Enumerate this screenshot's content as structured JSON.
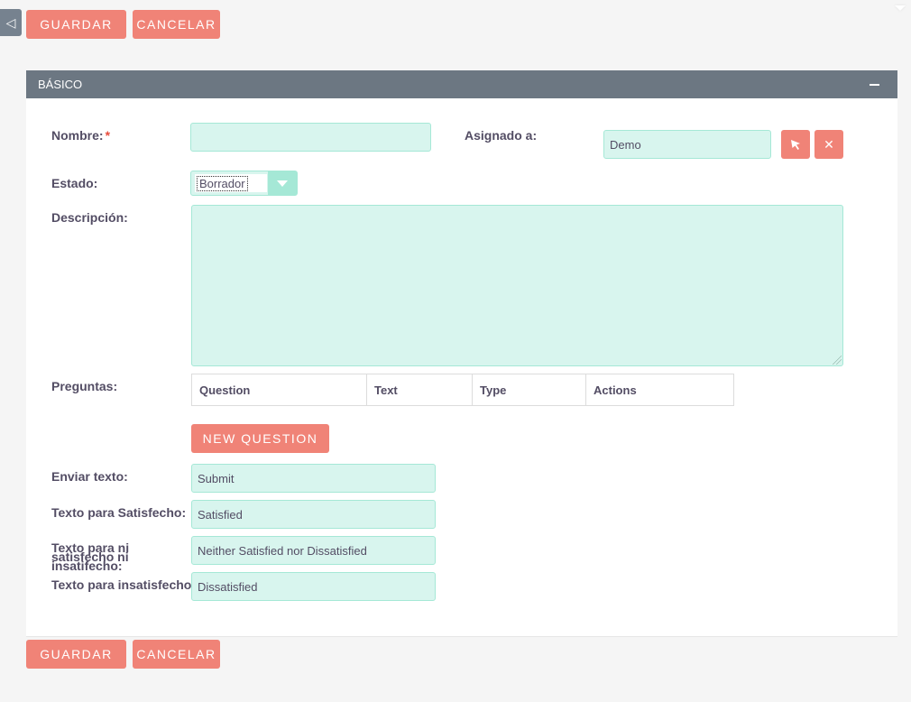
{
  "toolbar": {
    "save_label": "GUARDAR",
    "cancel_label": "CANCELAR"
  },
  "panel": {
    "title": "BÁSICO"
  },
  "form": {
    "nombre_label": "Nombre:",
    "required_mark": "*",
    "nombre_value": "",
    "asignado_label": "Asignado a:",
    "asignado_value": "Demo",
    "estado_label": "Estado:",
    "estado_value": "Borrador",
    "descripcion_label": "Descripción:",
    "descripcion_value": "",
    "preguntas_label": "Preguntas:",
    "questions_table": {
      "columns": [
        "Question",
        "Text",
        "Type",
        "Actions"
      ]
    },
    "new_question_label": "NEW QUESTION",
    "enviar_label": "Enviar texto:",
    "enviar_value": "Submit",
    "satisfecho_label": "Texto para Satisfecho:",
    "satisfecho_value": "Satisfied",
    "neutral_label": "Texto para ni satisfecho ni insatifecho:",
    "neutral_value": "Neither Satisfied nor Dissatisfied",
    "insatisfecho_label": "Texto para insatisfecho:",
    "insatisfecho_value": "Dissatisfied"
  },
  "icons": {
    "collapse": "collapse-left-icon",
    "select_user": "cursor-select-icon",
    "clear": "close-icon"
  },
  "colors": {
    "accent": "#f08377",
    "field_bg": "#d8f5ee",
    "field_border": "#a5e8d6",
    "header_bg": "#6c7782"
  }
}
